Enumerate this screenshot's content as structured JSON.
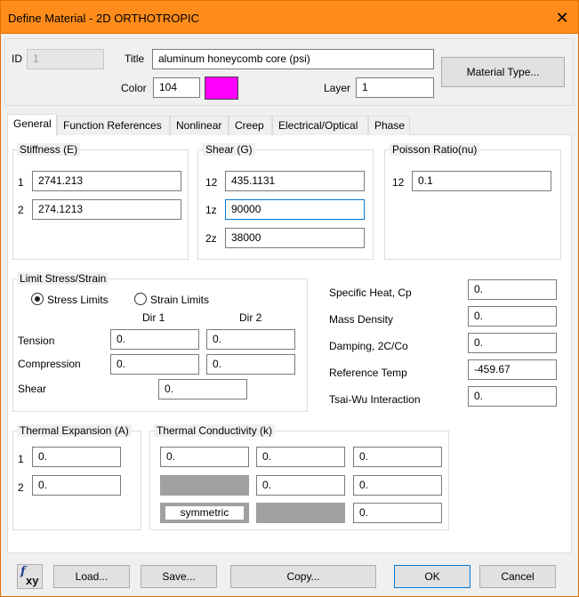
{
  "window": {
    "title": "Define Material - 2D ORTHOTROPIC",
    "close_glyph": "✕"
  },
  "header": {
    "id_label": "ID",
    "id_value": "1",
    "title_label": "Title",
    "title_value": "aluminum honeycomb core (psi)",
    "color_label": "Color",
    "color_value": "104",
    "color_swatch": "#ff00ff",
    "layer_label": "Layer",
    "layer_value": "1",
    "material_type_button": "Material Type..."
  },
  "tabs": [
    "General",
    "Function References",
    "Nonlinear",
    "Creep",
    "Electrical/Optical",
    "Phase"
  ],
  "stiffness": {
    "title": "Stiffness (E)",
    "rows": [
      {
        "label": "1",
        "value": "2741.213"
      },
      {
        "label": "2",
        "value": "274.1213"
      }
    ]
  },
  "shear": {
    "title": "Shear (G)",
    "rows": [
      {
        "label": "12",
        "value": "435.1131"
      },
      {
        "label": "1z",
        "value": "90000"
      },
      {
        "label": "2z",
        "value": "38000"
      }
    ]
  },
  "poisson": {
    "title": "Poisson Ratio(nu)",
    "rows": [
      {
        "label": "12",
        "value": "0.1"
      }
    ]
  },
  "limit": {
    "title": "Limit Stress/Strain",
    "stress_radio": "Stress Limits",
    "strain_radio": "Strain Limits",
    "dir1": "Dir 1",
    "dir2": "Dir 2",
    "tension_label": "Tension",
    "tension": [
      "0.",
      "0."
    ],
    "compression_label": "Compression",
    "compression": [
      "0.",
      "0."
    ],
    "shear_label": "Shear",
    "shear": "0."
  },
  "props": [
    {
      "label": "Specific Heat, Cp",
      "value": "0."
    },
    {
      "label": "Mass Density",
      "value": "0."
    },
    {
      "label": "Damping, 2C/Co",
      "value": "0."
    },
    {
      "label": "Reference Temp",
      "value": "-459.67"
    },
    {
      "label": "Tsai-Wu Interaction",
      "value": "0."
    }
  ],
  "thermal_expansion": {
    "title": "Thermal Expansion (A)",
    "rows": [
      {
        "label": "1",
        "value": "0."
      },
      {
        "label": "2",
        "value": "0."
      }
    ]
  },
  "thermal_conductivity": {
    "title": "Thermal Conductivity (k)",
    "row1": [
      "0.",
      "0.",
      "0."
    ],
    "row2": [
      "0.",
      "0."
    ],
    "row3": "0.",
    "symmetric_label": "symmetric"
  },
  "footer": {
    "fxy_icon": "fxy",
    "load": "Load...",
    "save": "Save...",
    "copy": "Copy...",
    "ok": "OK",
    "cancel": "Cancel"
  }
}
